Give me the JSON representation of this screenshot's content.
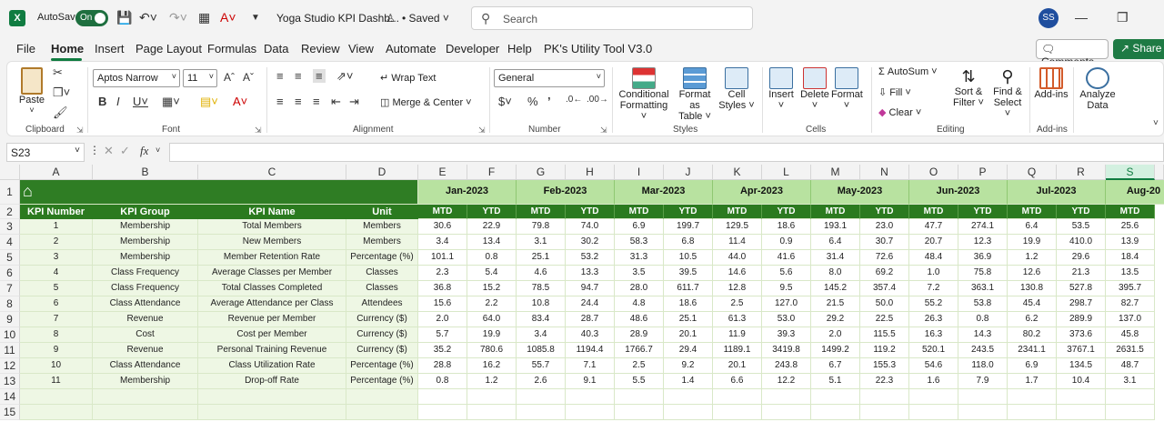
{
  "titlebar": {
    "app_icon": "X",
    "autosave_label": "AutoSave",
    "autosave_state": "On",
    "doc_title": "Yoga Studio KPI Dashb...",
    "saved_status": "• Saved",
    "search_placeholder": "Search",
    "user_initials": "SS"
  },
  "menu": {
    "tabs": [
      "File",
      "Home",
      "Insert",
      "Page Layout",
      "Formulas",
      "Data",
      "Review",
      "View",
      "Automate",
      "Developer",
      "Help",
      "PK's Utility Tool V3.0"
    ],
    "comments_label": "Comments",
    "share_label": "Share"
  },
  "ribbon": {
    "clipboard": {
      "paste": "Paste",
      "label": "Clipboard"
    },
    "font": {
      "name": "Aptos Narrow",
      "size": "11",
      "label": "Font"
    },
    "alignment": {
      "wrap_text": "Wrap Text",
      "merge_center": "Merge & Center",
      "label": "Alignment"
    },
    "number": {
      "format": "General",
      "label": "Number"
    },
    "styles": {
      "conditional": "Conditional",
      "formatting": "Formatting",
      "format_as": "Format as",
      "table": "Table",
      "cell": "Cell",
      "styles": "Styles",
      "label": "Styles"
    },
    "cells": {
      "insert": "Insert",
      "delete": "Delete",
      "format": "Format",
      "label": "Cells"
    },
    "editing": {
      "autosum": "AutoSum",
      "fill": "Fill",
      "clear": "Clear",
      "sort": "Sort &",
      "filter": "Filter",
      "find": "Find &",
      "select": "Select",
      "label": "Editing"
    },
    "addins": {
      "addins": "Add-ins",
      "label": "Add-ins"
    },
    "analyze": {
      "analyze": "Analyze",
      "data": "Data"
    }
  },
  "formula_bar": {
    "name_box": "S23",
    "fx": "fx",
    "content": ""
  },
  "sheet": {
    "columns": [
      "A",
      "B",
      "C",
      "D",
      "E",
      "F",
      "G",
      "H",
      "I",
      "J",
      "K",
      "L",
      "M",
      "N",
      "O",
      "P",
      "Q",
      "R",
      "S"
    ],
    "selected_column": "S",
    "rows": [
      "1",
      "2",
      "3",
      "4",
      "5",
      "6",
      "7",
      "8",
      "9",
      "10",
      "11",
      "12",
      "13",
      "14",
      "15"
    ],
    "headers": [
      "KPI Number",
      "KPI Group",
      "KPI Name",
      "Unit"
    ],
    "months": [
      "Jan-2023",
      "Feb-2023",
      "Mar-2023",
      "Apr-2023",
      "May-2023",
      "Jun-2023",
      "Jul-2023",
      "Aug-20"
    ],
    "mtd": "MTD",
    "ytd": "YTD",
    "kpis": [
      {
        "num": "1",
        "group": "Membership",
        "name": "Total Members",
        "unit": "Members",
        "vals": [
          "30.6",
          "22.9",
          "79.8",
          "74.0",
          "6.9",
          "199.7",
          "129.5",
          "18.6",
          "193.1",
          "23.0",
          "47.7",
          "274.1",
          "6.4",
          "53.5",
          "25.6"
        ]
      },
      {
        "num": "2",
        "group": "Membership",
        "name": "New Members",
        "unit": "Members",
        "vals": [
          "3.4",
          "13.4",
          "3.1",
          "30.2",
          "58.3",
          "6.8",
          "11.4",
          "0.9",
          "6.4",
          "30.7",
          "20.7",
          "12.3",
          "19.9",
          "410.0",
          "13.9"
        ]
      },
      {
        "num": "3",
        "group": "Membership",
        "name": "Member Retention Rate",
        "unit": "Percentage (%)",
        "vals": [
          "101.1",
          "0.8",
          "25.1",
          "53.2",
          "31.3",
          "10.5",
          "44.0",
          "41.6",
          "31.4",
          "72.6",
          "48.4",
          "36.9",
          "1.2",
          "29.6",
          "18.4"
        ]
      },
      {
        "num": "4",
        "group": "Class Frequency",
        "name": "Average Classes per Member",
        "unit": "Classes",
        "vals": [
          "2.3",
          "5.4",
          "4.6",
          "13.3",
          "3.5",
          "39.5",
          "14.6",
          "5.6",
          "8.0",
          "69.2",
          "1.0",
          "75.8",
          "12.6",
          "21.3",
          "13.5"
        ]
      },
      {
        "num": "5",
        "group": "Class Frequency",
        "name": "Total Classes Completed",
        "unit": "Classes",
        "vals": [
          "36.8",
          "15.2",
          "78.5",
          "94.7",
          "28.0",
          "611.7",
          "12.8",
          "9.5",
          "145.2",
          "357.4",
          "7.2",
          "363.1",
          "130.8",
          "527.8",
          "395.7"
        ]
      },
      {
        "num": "6",
        "group": "Class Attendance",
        "name": "Average Attendance per Class",
        "unit": "Attendees",
        "vals": [
          "15.6",
          "2.2",
          "10.8",
          "24.4",
          "4.8",
          "18.6",
          "2.5",
          "127.0",
          "21.5",
          "50.0",
          "55.2",
          "53.8",
          "45.4",
          "298.7",
          "82.7"
        ]
      },
      {
        "num": "7",
        "group": "Revenue",
        "name": "Revenue per Member",
        "unit": "Currency ($)",
        "vals": [
          "2.0",
          "64.0",
          "83.4",
          "28.7",
          "48.6",
          "25.1",
          "61.3",
          "53.0",
          "29.2",
          "22.5",
          "26.3",
          "0.8",
          "6.2",
          "289.9",
          "137.0"
        ]
      },
      {
        "num": "8",
        "group": "Cost",
        "name": "Cost per Member",
        "unit": "Currency ($)",
        "vals": [
          "5.7",
          "19.9",
          "3.4",
          "40.3",
          "28.9",
          "20.1",
          "11.9",
          "39.3",
          "2.0",
          "115.5",
          "16.3",
          "14.3",
          "80.2",
          "373.6",
          "45.8"
        ]
      },
      {
        "num": "9",
        "group": "Revenue",
        "name": "Personal Training Revenue",
        "unit": "Currency ($)",
        "vals": [
          "35.2",
          "780.6",
          "1085.8",
          "1194.4",
          "1766.7",
          "29.4",
          "1189.1",
          "3419.8",
          "1499.2",
          "119.2",
          "520.1",
          "243.5",
          "2341.1",
          "3767.1",
          "2631.5"
        ]
      },
      {
        "num": "10",
        "group": "Class Attendance",
        "name": "Class Utilization Rate",
        "unit": "Percentage (%)",
        "vals": [
          "28.8",
          "16.2",
          "55.7",
          "7.1",
          "2.5",
          "9.2",
          "20.1",
          "243.8",
          "6.7",
          "155.3",
          "54.6",
          "118.0",
          "6.9",
          "134.5",
          "48.7"
        ]
      },
      {
        "num": "11",
        "group": "Membership",
        "name": "Drop-off Rate",
        "unit": "Percentage (%)",
        "vals": [
          "0.8",
          "1.2",
          "2.6",
          "9.1",
          "5.5",
          "1.4",
          "6.6",
          "12.2",
          "5.1",
          "22.3",
          "1.6",
          "7.9",
          "1.7",
          "10.4",
          "3.1"
        ]
      }
    ]
  },
  "colors": {
    "accent": "#107c41",
    "header_green": "#2b7a1f",
    "month_green": "#b8e2a0",
    "light_row": "#eef7e4"
  }
}
